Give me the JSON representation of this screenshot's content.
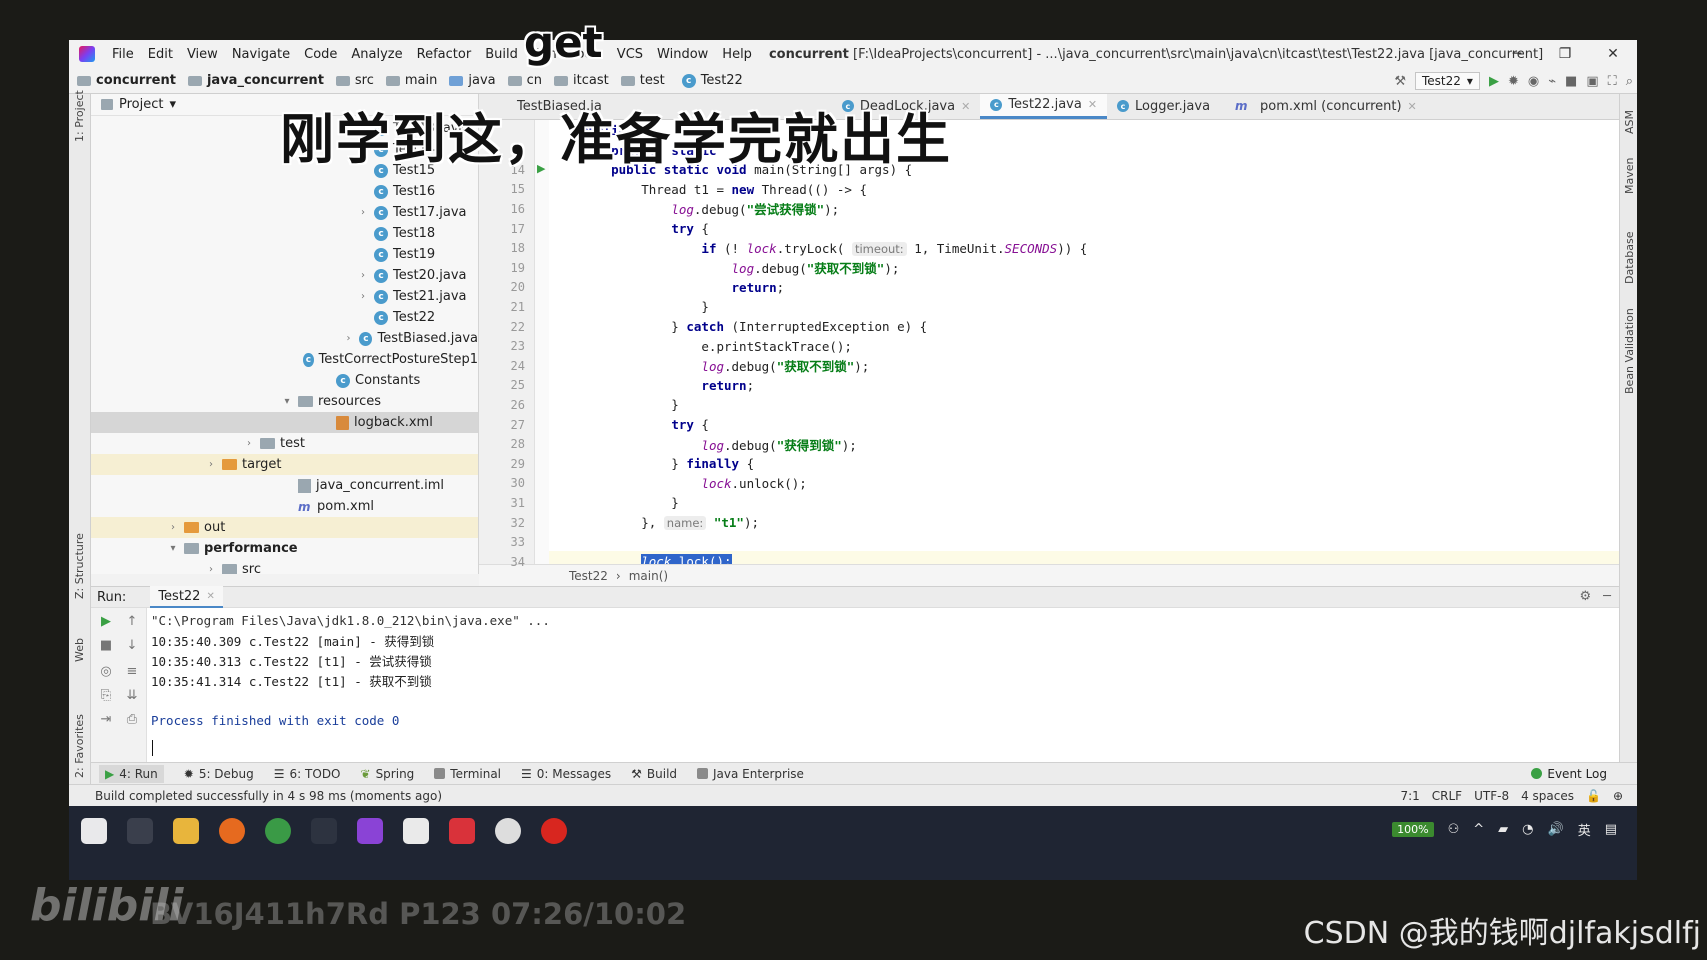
{
  "titlebar": {
    "menus": [
      "File",
      "Edit",
      "View",
      "Navigate",
      "Code",
      "Analyze",
      "Refactor",
      "Build",
      "Run",
      "Tools",
      "VCS",
      "Window",
      "Help"
    ],
    "project": "concurrent",
    "path": "[F:\\IdeaProjects\\concurrent] - ...\\java_concurrent\\src\\main\\java\\cn\\itcast\\test\\Test22.java [java_concurrent]"
  },
  "navbar": {
    "crumbs": [
      "concurrent",
      "java_concurrent",
      "src",
      "main",
      "java",
      "cn",
      "itcast",
      "test",
      "Test22"
    ],
    "run_config": "Test22"
  },
  "project_panel": {
    "header": "Project",
    "rows": [
      {
        "label": "Test13.java",
        "kind": "class",
        "expand": true
      },
      {
        "label": "Test14",
        "kind": "class"
      },
      {
        "label": "Test15",
        "kind": "class"
      },
      {
        "label": "Test16",
        "kind": "class"
      },
      {
        "label": "Test17.java",
        "kind": "class",
        "expand": true
      },
      {
        "label": "Test18",
        "kind": "class"
      },
      {
        "label": "Test19",
        "kind": "class"
      },
      {
        "label": "Test20.java",
        "kind": "class",
        "expand": true
      },
      {
        "label": "Test21.java",
        "kind": "class",
        "expand": true
      },
      {
        "label": "Test22",
        "kind": "class"
      },
      {
        "label": "TestBiased.java",
        "kind": "class",
        "expand": true
      },
      {
        "label": "TestCorrectPostureStep1",
        "kind": "class"
      },
      {
        "label": "Constants",
        "kind": "class"
      },
      {
        "label": "resources",
        "kind": "folder"
      },
      {
        "label": "logback.xml",
        "kind": "xml"
      },
      {
        "label": "test",
        "kind": "folder"
      },
      {
        "label": "target",
        "kind": "folder-orange"
      },
      {
        "label": "java_concurrent.iml",
        "kind": "iml"
      },
      {
        "label": "pom.xml",
        "kind": "maven"
      },
      {
        "label": "out",
        "kind": "folder-orange"
      },
      {
        "label": "performance",
        "kind": "folder"
      },
      {
        "label": "src",
        "kind": "folder"
      }
    ]
  },
  "tabs": [
    {
      "label": "TestBiased.ja",
      "active": false
    },
    {
      "label": "DeadLock.java",
      "active": false
    },
    {
      "label": "Test22.java",
      "active": true
    },
    {
      "label": "Logger.java",
      "active": false
    },
    {
      "label": "pom.xml (concurrent)",
      "active": false
    }
  ],
  "editor": {
    "lines": [
      {
        "n": "",
        "text": "public"
      },
      {
        "n": "",
        "text": "    private static"
      },
      {
        "n": "14",
        "text": "    public static void main(String[] args) {"
      },
      {
        "n": "15",
        "text": "        Thread t1 = new Thread(() -> {"
      },
      {
        "n": "16",
        "text": "            log.debug(\"尝试获得锁\");"
      },
      {
        "n": "17",
        "text": "            try {"
      },
      {
        "n": "18",
        "text": "                if (! lock.tryLock( timeout: 1, TimeUnit.SECONDS)) {"
      },
      {
        "n": "19",
        "text": "                    log.debug(\"获取不到锁\");"
      },
      {
        "n": "20",
        "text": "                    return;"
      },
      {
        "n": "21",
        "text": "                }"
      },
      {
        "n": "22",
        "text": "            } catch (InterruptedException e) {"
      },
      {
        "n": "23",
        "text": "                e.printStackTrace();"
      },
      {
        "n": "24",
        "text": "                log.debug(\"获取不到锁\");"
      },
      {
        "n": "25",
        "text": "                return;"
      },
      {
        "n": "26",
        "text": "            }"
      },
      {
        "n": "27",
        "text": "            try {"
      },
      {
        "n": "28",
        "text": "                log.debug(\"获得到锁\");"
      },
      {
        "n": "29",
        "text": "            } finally {"
      },
      {
        "n": "30",
        "text": "                lock.unlock();"
      },
      {
        "n": "31",
        "text": "            }"
      },
      {
        "n": "32",
        "text": "        }, name: \"t1\");"
      },
      {
        "n": "33",
        "text": ""
      },
      {
        "n": "34",
        "text": "        lock.lock();"
      }
    ],
    "breadcrumb": [
      "Test22",
      "main()"
    ]
  },
  "run_panel": {
    "label": "Run:",
    "tab": "Test22",
    "console": [
      "\"C:\\Program Files\\Java\\jdk1.8.0_212\\bin\\java.exe\" ...",
      "10:35:40.309 c.Test22 [main] - 获得到锁",
      "10:35:40.313 c.Test22 [t1] - 尝试获得锁",
      "10:35:41.314 c.Test22 [t1] - 获取不到锁",
      "",
      "Process finished with exit code 0"
    ]
  },
  "toolwindows": [
    "4: Run",
    "5: Debug",
    "6: TODO",
    "Spring",
    "Terminal",
    "0: Messages",
    "Build",
    "Java Enterprise"
  ],
  "event_log": "Event Log",
  "status": {
    "message": "Build completed successfully in 4 s 98 ms (moments ago)",
    "position": "7:1",
    "line_sep": "CRLF",
    "encoding": "UTF-8",
    "indent": "4 spaces"
  },
  "left_stripe": [
    "1: Project",
    "Z: Structure",
    "Web",
    "2: Favorites"
  ],
  "right_stripe": [
    "ASM",
    "Maven",
    "Database",
    "Bean Validation"
  ],
  "taskbar": {
    "battery": "100%",
    "ime": "英"
  },
  "overlay": {
    "subtitle": "刚学到这，准备学完就出生",
    "word": "get",
    "bili": "bilibili",
    "bili_info": "BV16J411h7Rd  P123  07:26/10:02",
    "csdn": "CSDN @我的钱啊djlfakjsdlfj"
  }
}
